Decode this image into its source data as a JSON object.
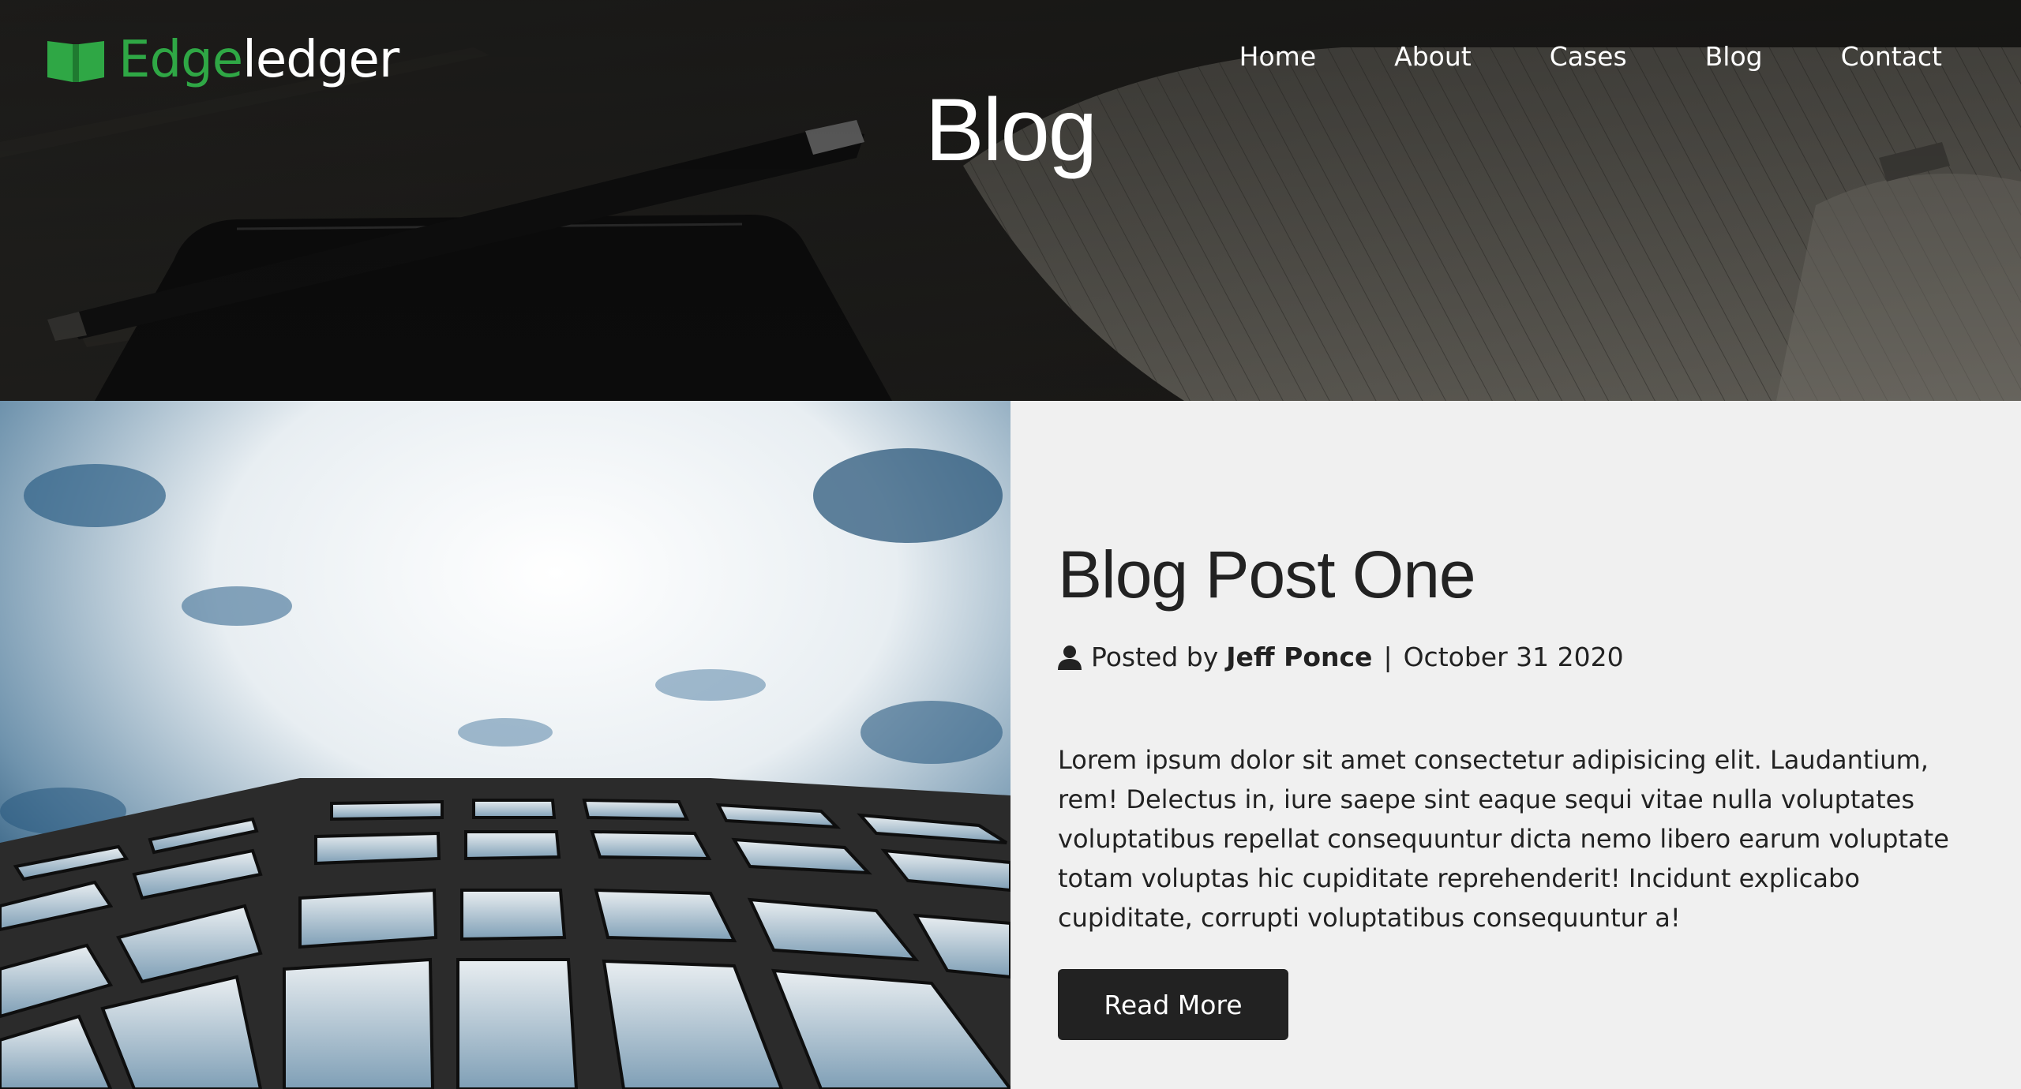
{
  "header": {
    "logo_green": "Edge",
    "logo_white": "ledger",
    "nav": [
      "Home",
      "About",
      "Cases",
      "Blog",
      "Contact"
    ],
    "page_title": "Blog"
  },
  "post": {
    "title": "Blog Post One",
    "posted_by_label": "Posted by",
    "author": "Jeff Ponce",
    "separator": "|",
    "date": "October 31 2020",
    "excerpt": "Lorem ipsum dolor sit amet consectetur adipisicing elit. Laudantium, rem! Delectus in, iure saepe sint eaque sequi vitae nulla voluptates voluptatibus repellat consequuntur dicta nemo libero earum voluptate totam voluptas hic cupiditate reprehenderit! Incidunt explicabo cupiditate, corrupti voluptatibus consequuntur a!",
    "button_label": "Read More"
  },
  "colors": {
    "brand_green": "#2fa745",
    "button_dark": "#222222",
    "section_bg": "#f0f0f0"
  },
  "icons": {
    "logo": "open-book-icon",
    "meta": "user-icon"
  }
}
